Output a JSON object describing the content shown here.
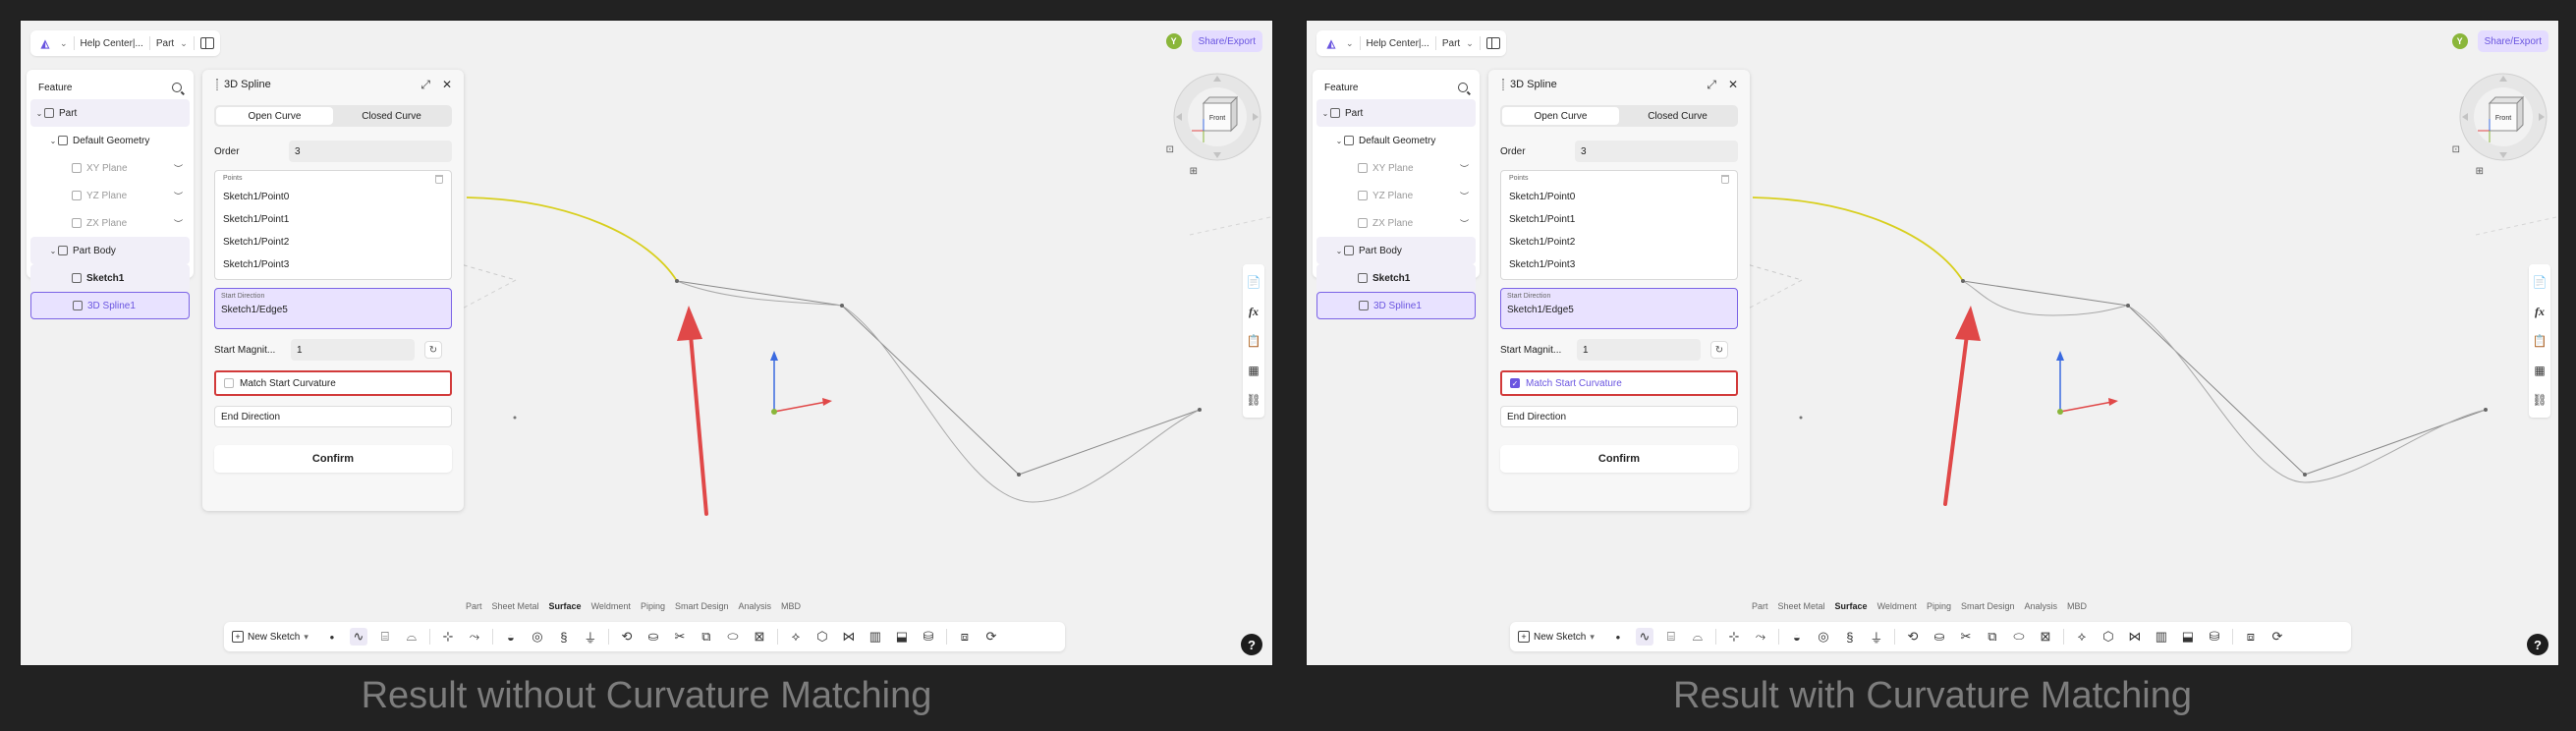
{
  "panels": [
    {
      "key": "left",
      "caption": "Result without Curvature Matching",
      "match_checked": false
    },
    {
      "key": "right",
      "caption": "Result with Curvature Matching",
      "match_checked": true
    }
  ],
  "topbar": {
    "breadcrumb": "Help Center|...",
    "mode": "Part",
    "avatar": "Y",
    "share_label": "Share/Export"
  },
  "feature_tree": {
    "title": "Feature",
    "items": [
      {
        "label": "Part",
        "level": 0,
        "arrow": "⌄"
      },
      {
        "label": "Default Geometry",
        "level": 1,
        "arrow": "⌄"
      },
      {
        "label": "XY Plane",
        "level": 2
      },
      {
        "label": "YZ Plane",
        "level": 2
      },
      {
        "label": "ZX Plane",
        "level": 2
      },
      {
        "label": "Part Body",
        "level": 1,
        "arrow": "⌄"
      },
      {
        "label": "Sketch1",
        "level": 2
      },
      {
        "label": "3D Spline1",
        "level": 2
      }
    ]
  },
  "spline_panel": {
    "title": "3D Spline",
    "tab_open": "Open Curve",
    "tab_closed": "Closed Curve",
    "order_label": "Order",
    "order_value": "3",
    "points_header": "Points",
    "points": [
      "Sketch1/Point0",
      "Sketch1/Point1",
      "Sketch1/Point2",
      "Sketch1/Point3"
    ],
    "start_direction_header": "Start Direction",
    "start_direction_value": "Sketch1/Edge5",
    "start_magnitude_label": "Start Magnit...",
    "start_magnitude_value": "1",
    "match_label": "Match Start Curvature",
    "end_direction_label": "End Direction",
    "confirm_label": "Confirm"
  },
  "navcube": {
    "face_label": "Front"
  },
  "ribbon_tabs": [
    "Part",
    "Sheet Metal",
    "Surface",
    "Weldment",
    "Piping",
    "Smart Design",
    "Analysis",
    "MBD"
  ],
  "ribbon_active": "Surface",
  "toolbar": {
    "new_sketch": "New Sketch"
  },
  "side_tools": [
    "📄",
    "fx",
    "📋",
    "▦",
    "⛓"
  ],
  "help": "?",
  "colors": {
    "accent": "#6a55e0",
    "highlight_box": "#d23a3a",
    "arrow": "#e04848",
    "spline_yellow": "#d8cf1e",
    "axis_x": "#e04848",
    "axis_y": "#3a6ae0",
    "axis_z_dot": "#8ab63a"
  }
}
